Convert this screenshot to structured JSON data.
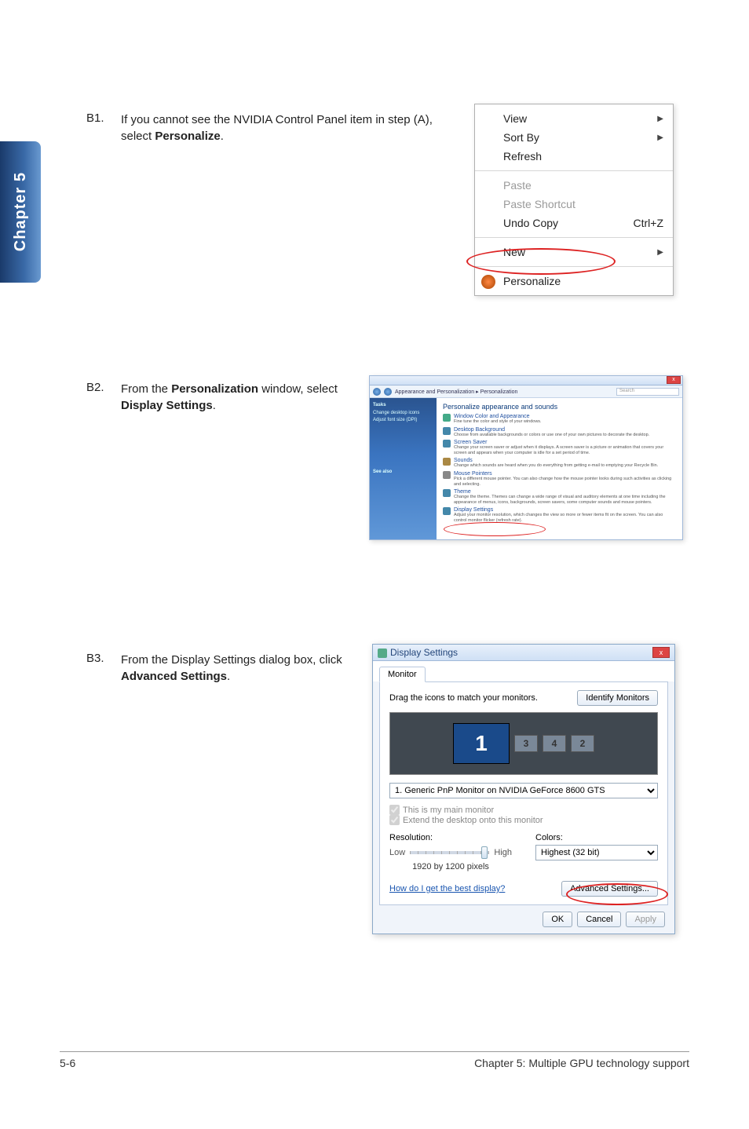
{
  "chapter_tab": "Chapter 5",
  "steps": {
    "b1": {
      "num": "B1.",
      "pre": "If you cannot see the NVIDIA Control Panel item in step (A), select ",
      "bold": "Personalize",
      "post": "."
    },
    "b2": {
      "num": "B2.",
      "pre": "From the ",
      "bold1": "Personalization",
      "mid": " window, select ",
      "bold2": "Display Settings",
      "post": "."
    },
    "b3": {
      "num": "B3.",
      "pre": "From the Display Settings dialog box, click ",
      "bold": "Advanced Settings",
      "post": "."
    }
  },
  "ctxmenu": {
    "view": "View",
    "sortby": "Sort By",
    "refresh": "Refresh",
    "paste": "Paste",
    "paste_shortcut": "Paste Shortcut",
    "undo_copy": "Undo Copy",
    "undo_shortcut": "Ctrl+Z",
    "new": "New",
    "personalize": "Personalize"
  },
  "pwin": {
    "breadcrumb": "Appearance and Personalization  ▸  Personalization",
    "search_placeholder": "Search",
    "sidebar": {
      "heading": "Tasks",
      "link1": "Change desktop icons",
      "link2": "Adjust font size (DPI)",
      "seealso": "See also"
    },
    "content": {
      "header": "Personalize appearance and sounds",
      "items": [
        {
          "title": "Window Color and Appearance",
          "desc": "Fine tune the color and style of your windows."
        },
        {
          "title": "Desktop Background",
          "desc": "Choose from available backgrounds or colors or use one of your own pictures to decorate the desktop."
        },
        {
          "title": "Screen Saver",
          "desc": "Change your screen saver or adjust when it displays. A screen saver is a picture or animation that covers your screen and appears when your computer is idle for a set period of time."
        },
        {
          "title": "Sounds",
          "desc": "Change which sounds are heard when you do everything from getting e-mail to emptying your Recycle Bin."
        },
        {
          "title": "Mouse Pointers",
          "desc": "Pick a different mouse pointer. You can also change how the mouse pointer looks during such activities as clicking and selecting."
        },
        {
          "title": "Theme",
          "desc": "Change the theme. Themes can change a wide range of visual and auditory elements at one time including the appearance of menus, icons, backgrounds, screen savers, some computer sounds and mouse pointers."
        },
        {
          "title": "Display Settings",
          "desc": "Adjust your monitor resolution, which changes the view so more or fewer items fit on the screen. You can also control monitor flicker (refresh rate)."
        }
      ]
    }
  },
  "ds": {
    "title": "Display Settings",
    "tab": "Monitor",
    "drag_text": "Drag the icons to match your monitors.",
    "identify": "Identify Monitors",
    "monitors": {
      "m1": "1",
      "m3": "3",
      "m4": "4",
      "m2": "2"
    },
    "monitor_select": "1. Generic PnP Monitor on NVIDIA GeForce 8600 GTS",
    "cb_main": "This is my main monitor",
    "cb_extend": "Extend the desktop onto this monitor",
    "resolution_label": "Resolution:",
    "res_low": "Low",
    "res_high": "High",
    "res_value": "1920 by 1200 pixels",
    "colors_label": "Colors:",
    "colors_value": "Highest (32 bit)",
    "help_link": "How do I get the best display?",
    "advanced": "Advanced Settings...",
    "ok": "OK",
    "cancel": "Cancel",
    "apply": "Apply"
  },
  "footer": {
    "left": "5-6",
    "right": "Chapter 5: Multiple GPU technology support"
  }
}
